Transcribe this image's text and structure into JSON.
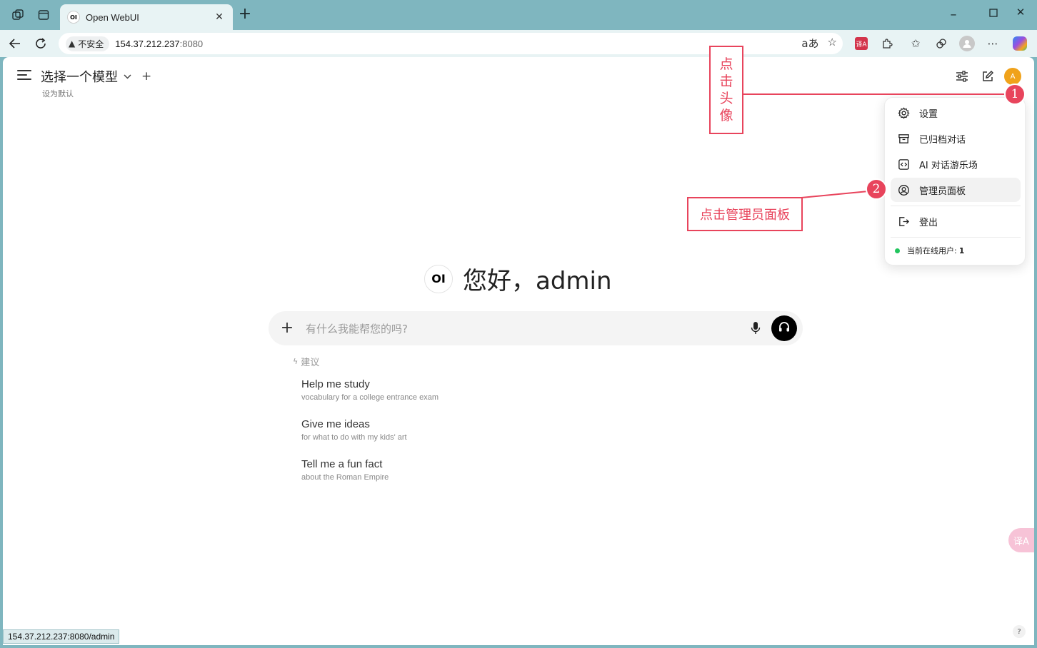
{
  "browser": {
    "tab_title": "Open WebUI",
    "tab_favicon_text": "OI",
    "security_label": "不安全",
    "url_host": "154.37.212.237",
    "url_port": ":8080",
    "status_url": "154.37.212.237:8080/admin",
    "ext_translate_text": "译A"
  },
  "header": {
    "model_select_label": "选择一个模型",
    "set_default_label": "设为默认",
    "avatar_initial": "A"
  },
  "menu": {
    "items": [
      {
        "label": "设置",
        "icon": "gear-icon"
      },
      {
        "label": "已归档对话",
        "icon": "archive-icon"
      },
      {
        "label": "AI 对话游乐场",
        "icon": "code-icon"
      },
      {
        "label": "管理员面板",
        "icon": "user-circle-icon"
      },
      {
        "label": "登出",
        "icon": "logout-icon"
      }
    ],
    "online_label": "当前在线用户:",
    "online_count": "1"
  },
  "main": {
    "logo_text": "OI",
    "greeting": "您好，admin",
    "input_placeholder": "有什么我能帮您的吗?",
    "suggestions_heading": "建议",
    "suggestions": [
      {
        "title": "Help me study",
        "subtitle": "vocabulary for a college entrance exam"
      },
      {
        "title": "Give me ideas",
        "subtitle": "for what to do with my kids' art"
      },
      {
        "title": "Tell me a fun fact",
        "subtitle": "about the Roman Empire"
      }
    ],
    "translate_fab_text": "译A",
    "help_text": "?"
  },
  "annotations": {
    "step1_label": "点击头像",
    "step1_chars": [
      "点",
      "击",
      "头",
      "像"
    ],
    "step1_number": "1",
    "step2_label": "点击管理员面板",
    "step2_number": "2"
  },
  "colors": {
    "accent_annotation": "#e8445c",
    "browser_frame": "#7fb6bf",
    "avatar": "#f0a21a",
    "online_dot": "#22c55e"
  }
}
